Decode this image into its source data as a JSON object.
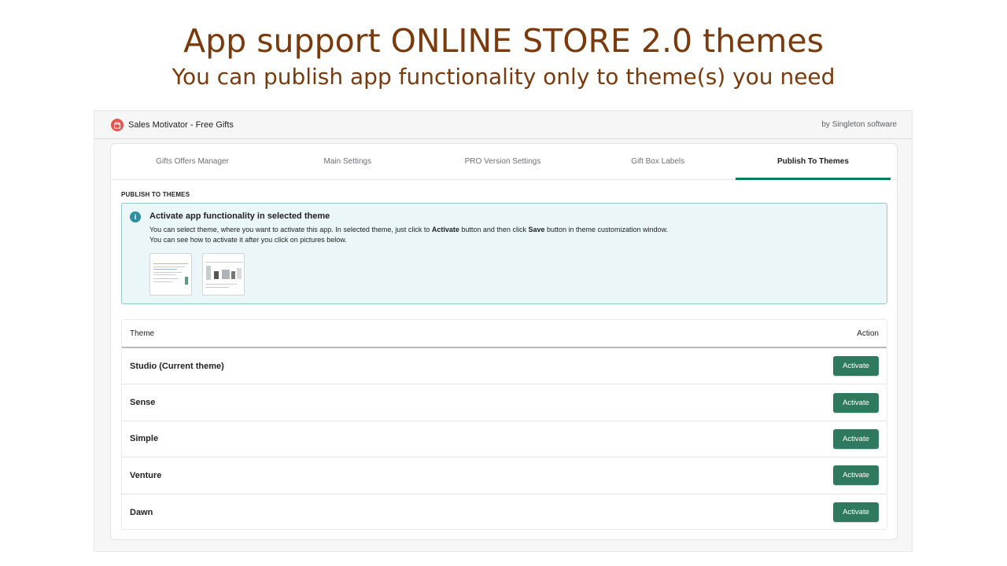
{
  "headline": {
    "title": "App support ONLINE STORE 2.0 themes",
    "subtitle": "You can publish app functionality only to theme(s) you need"
  },
  "app": {
    "title": "Sales Motivator - Free Gifts",
    "by": "by Singleton software",
    "logo_icon": "gift-icon"
  },
  "tabs": [
    {
      "label": "Gifts Offers Manager",
      "active": false
    },
    {
      "label": "Main Settings",
      "active": false
    },
    {
      "label": "PRO Version Settings",
      "active": false
    },
    {
      "label": "Gift Box Labels",
      "active": false
    },
    {
      "label": "Publish To Themes",
      "active": true
    }
  ],
  "section": {
    "label": "PUBLISH TO THEMES"
  },
  "banner": {
    "icon": "info-icon",
    "title": "Activate app functionality in selected theme",
    "line1_a": "You can select theme, where you want to activate this app. In selected theme, just click to ",
    "line1_b": "Activate",
    "line1_c": " button and then click ",
    "line1_d": "Save",
    "line1_e": " button in theme customization window.",
    "line2": "You can see how to activate it after you click on pictures below."
  },
  "table": {
    "col_theme": "Theme",
    "col_action": "Action",
    "rows": [
      {
        "theme": "Studio (Current theme)",
        "action": "Activate"
      },
      {
        "theme": "Sense",
        "action": "Activate"
      },
      {
        "theme": "Simple",
        "action": "Activate"
      },
      {
        "theme": "Venture",
        "action": "Activate"
      },
      {
        "theme": "Dawn",
        "action": "Activate"
      }
    ]
  },
  "colors": {
    "headline": "#7a3a0c",
    "accent": "#008060",
    "button": "#2f7a5f",
    "banner_bg": "#eaf6f7",
    "banner_border": "#98c6cd"
  }
}
